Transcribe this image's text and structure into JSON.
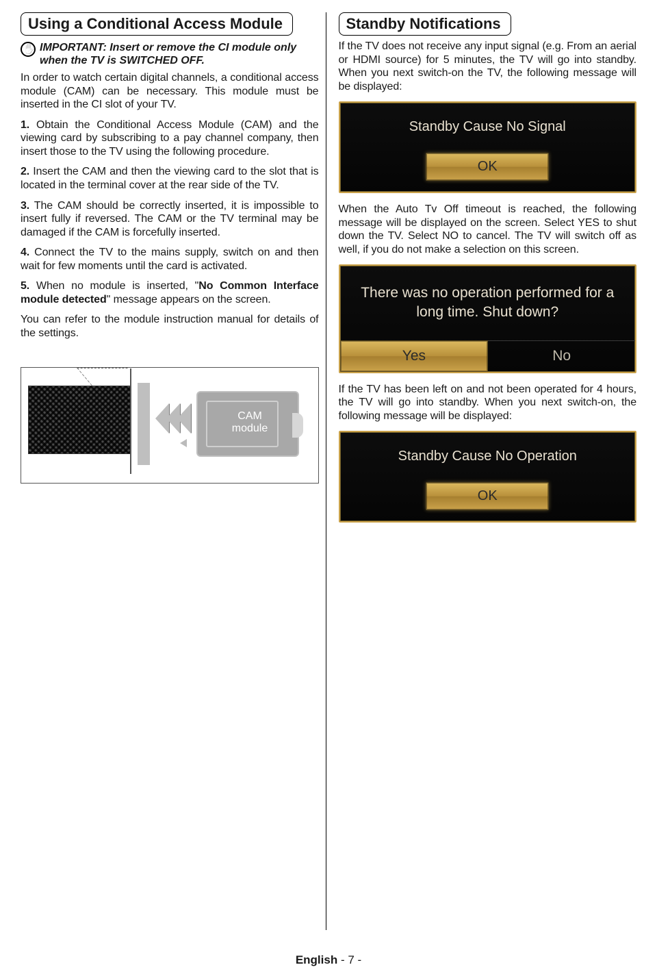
{
  "left": {
    "title": "Using a Conditional Access Module",
    "important": "IMPORTANT: Insert or remove the CI module only when the TV is SWITCHED OFF.",
    "intro": "In order to watch certain digital channels, a conditional access module (CAM) can be necessary. This module must be inserted in the CI slot of your TV.",
    "step1_num": "1.",
    "step1": " Obtain the Conditional Access Module (CAM) and the viewing card by subscribing to a pay channel company, then insert those to the TV using the following procedure.",
    "step2_num": "2.",
    "step2": " Insert the CAM and then the viewing card to the slot that is located in the terminal cover at the rear side of the TV.",
    "step3_num": "3.",
    "step3": " The CAM should be correctly inserted, it is impossible to insert fully if reversed. The CAM or the TV terminal may be damaged if the CAM is forcefully inserted.",
    "step4_num": "4.",
    "step4": " Connect the TV to the mains supply, switch on and then wait for few moments until the card is activated.",
    "step5_num": "5.",
    "step5a": " When no module is inserted, \"",
    "step5msg": "No Common Interface module detected",
    "step5b": "\" message appears on the screen.",
    "refer": "You can refer to the module instruction manual for details of the settings.",
    "cam_label": "CAM module"
  },
  "right": {
    "title": "Standby Notifications",
    "p1": "If the TV does not receive any input signal (e.g. From an aerial or HDMI source) for 5 minutes, the TV will go into standby. When you next switch-on the TV, the following message will be displayed:",
    "panel1_text": "Standby Cause No Signal",
    "ok": "OK",
    "p2": "When the Auto Tv Off timeout is reached, the following message will be displayed on the screen. Select YES to shut down the TV. Select NO to cancel. The TV will switch off as well, if you do not make a selection on this screen.",
    "panel2_text": "There was no operation performed for a long time. Shut down?",
    "yes": "Yes",
    "no": "No",
    "p3": "If the TV has been left on and not been operated for 4 hours, the TV will go into standby. When you next switch-on, the following message will be displayed:",
    "panel3_text": "Standby Cause No Operation"
  },
  "footer": {
    "lang": "English",
    "sep": "   - ",
    "page": "7",
    "sep2": " -"
  }
}
